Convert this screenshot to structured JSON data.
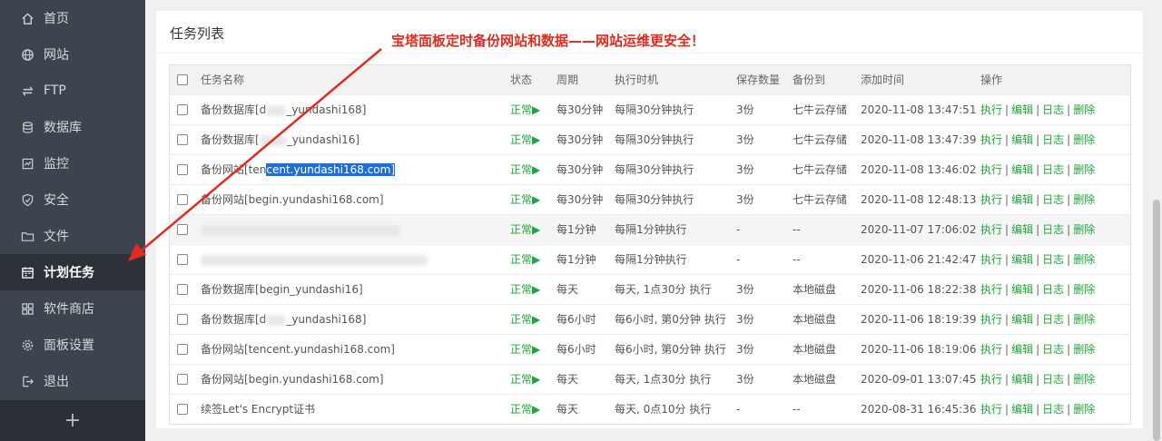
{
  "sidebar": {
    "items": [
      {
        "label": "首页",
        "icon": "home-icon"
      },
      {
        "label": "网站",
        "icon": "globe-icon"
      },
      {
        "label": "FTP",
        "icon": "ftp-icon"
      },
      {
        "label": "数据库",
        "icon": "database-icon"
      },
      {
        "label": "监控",
        "icon": "monitor-icon"
      },
      {
        "label": "安全",
        "icon": "shield-icon"
      },
      {
        "label": "文件",
        "icon": "folder-icon"
      },
      {
        "label": "计划任务",
        "icon": "calendar-icon",
        "active": true
      },
      {
        "label": "软件商店",
        "icon": "grid-icon"
      },
      {
        "label": "面板设置",
        "icon": "gear-icon"
      },
      {
        "label": "退出",
        "icon": "logout-icon"
      }
    ],
    "plus_label": "+"
  },
  "panel": {
    "title": "任务列表",
    "annotation": "宝塔面板定时备份网站和数据——网站运维更安全！"
  },
  "table": {
    "headers": {
      "name": "任务名称",
      "status": "状态",
      "period": "周期",
      "exec": "执行时机",
      "keep": "保存数量",
      "dest": "备份到",
      "time": "添加时间",
      "ops": "操作"
    },
    "ops": {
      "run": "执行",
      "edit": "编辑",
      "log": "日志",
      "del": "删除",
      "sep": "|"
    },
    "rows": [
      {
        "name_a": "备份数据库[d",
        "name_b": "",
        "name_c": "_yundashi168]",
        "status": "正常▶",
        "period": "每30分钟",
        "exec": "每隔30分钟执行",
        "keep": "3份",
        "dest": "七牛云存储",
        "time": "2020-11-08 13:47:51"
      },
      {
        "name_a": "备份数据库[",
        "name_b": "",
        "name_c": "_yundashi16]",
        "status": "正常▶",
        "period": "每30分钟",
        "exec": "每隔30分钟执行",
        "keep": "3份",
        "dest": "七牛云存储",
        "time": "2020-11-08 13:47:39"
      },
      {
        "name_a": "备份网站[ten",
        "name_b": "cent.yundashi168.com]",
        "name_c": "",
        "status": "正常▶",
        "period": "每30分钟",
        "exec": "每隔30分钟执行",
        "keep": "3份",
        "dest": "七牛云存储",
        "time": "2020-11-08 13:46:02"
      },
      {
        "name_a": "备份网站[begin.yundashi168.com]",
        "name_b": "",
        "name_c": "",
        "status": "正常▶",
        "period": "每30分钟",
        "exec": "每隔30分钟执行",
        "keep": "3份",
        "dest": "七牛云存储",
        "time": "2020-11-08 12:48:13"
      },
      {
        "name_a": "",
        "name_b": "",
        "name_c": "",
        "status": "正常▶",
        "period": "每1分钟",
        "exec": "每隔1分钟执行",
        "keep": "-",
        "dest": "--",
        "time": "2020-11-07 17:06:02"
      },
      {
        "name_a": "",
        "name_b": "",
        "name_c": "",
        "status": "正常▶",
        "period": "每1分钟",
        "exec": "每隔1分钟执行",
        "keep": "-",
        "dest": "--",
        "time": "2020-11-06 21:42:47"
      },
      {
        "name_a": "备份数据库[begin_yundashi16]",
        "name_b": "",
        "name_c": "",
        "status": "正常▶",
        "period": "每天",
        "exec": "每天, 1点30分 执行",
        "keep": "3份",
        "dest": "本地磁盘",
        "time": "2020-11-06 18:22:38"
      },
      {
        "name_a": "备份数据库[d",
        "name_b": "",
        "name_c": "_yundashi168]",
        "status": "正常▶",
        "period": "每6小时",
        "exec": "每6小时, 第0分钟 执行",
        "keep": "3份",
        "dest": "本地磁盘",
        "time": "2020-11-06 18:19:39"
      },
      {
        "name_a": "备份网站[tencent.yundashi168.com]",
        "name_b": "",
        "name_c": "",
        "status": "正常▶",
        "period": "每6小时",
        "exec": "每6小时, 第0分钟 执行",
        "keep": "3份",
        "dest": "本地磁盘",
        "time": "2020-11-06 18:19:06"
      },
      {
        "name_a": "备份网站[begin.yundashi168.com]",
        "name_b": "",
        "name_c": "",
        "status": "正常▶",
        "period": "每天",
        "exec": "每天, 1点30分 执行",
        "keep": "3份",
        "dest": "本地磁盘",
        "time": "2020-09-01 13:07:45"
      },
      {
        "name_a": "续签Let's Encrypt证书",
        "name_b": "",
        "name_c": "",
        "status": "正常▶",
        "period": "每天",
        "exec": "每天, 0点10分 执行",
        "keep": "-",
        "dest": "--",
        "time": "2020-08-31 16:45:36"
      }
    ]
  },
  "colors": {
    "sidebar": "#3c444d",
    "accent": "#20a53a",
    "annotation": "#e02b20",
    "selection": "#1e6ed6"
  }
}
